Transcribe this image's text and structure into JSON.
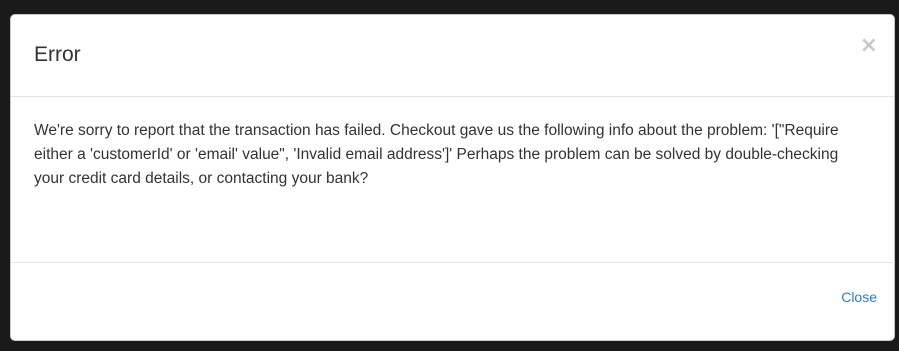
{
  "modal": {
    "title": "Error",
    "close_icon": "×",
    "message": "We're sorry to report that the transaction has failed. Checkout gave us the following info about the problem: '[\"Require either a 'customerId' or 'email' value\", 'Invalid email address']' Perhaps the problem can be solved by double-checking your credit card details, or contacting your bank?",
    "footer_close_label": "Close",
    "link_color": "#337ab7"
  }
}
